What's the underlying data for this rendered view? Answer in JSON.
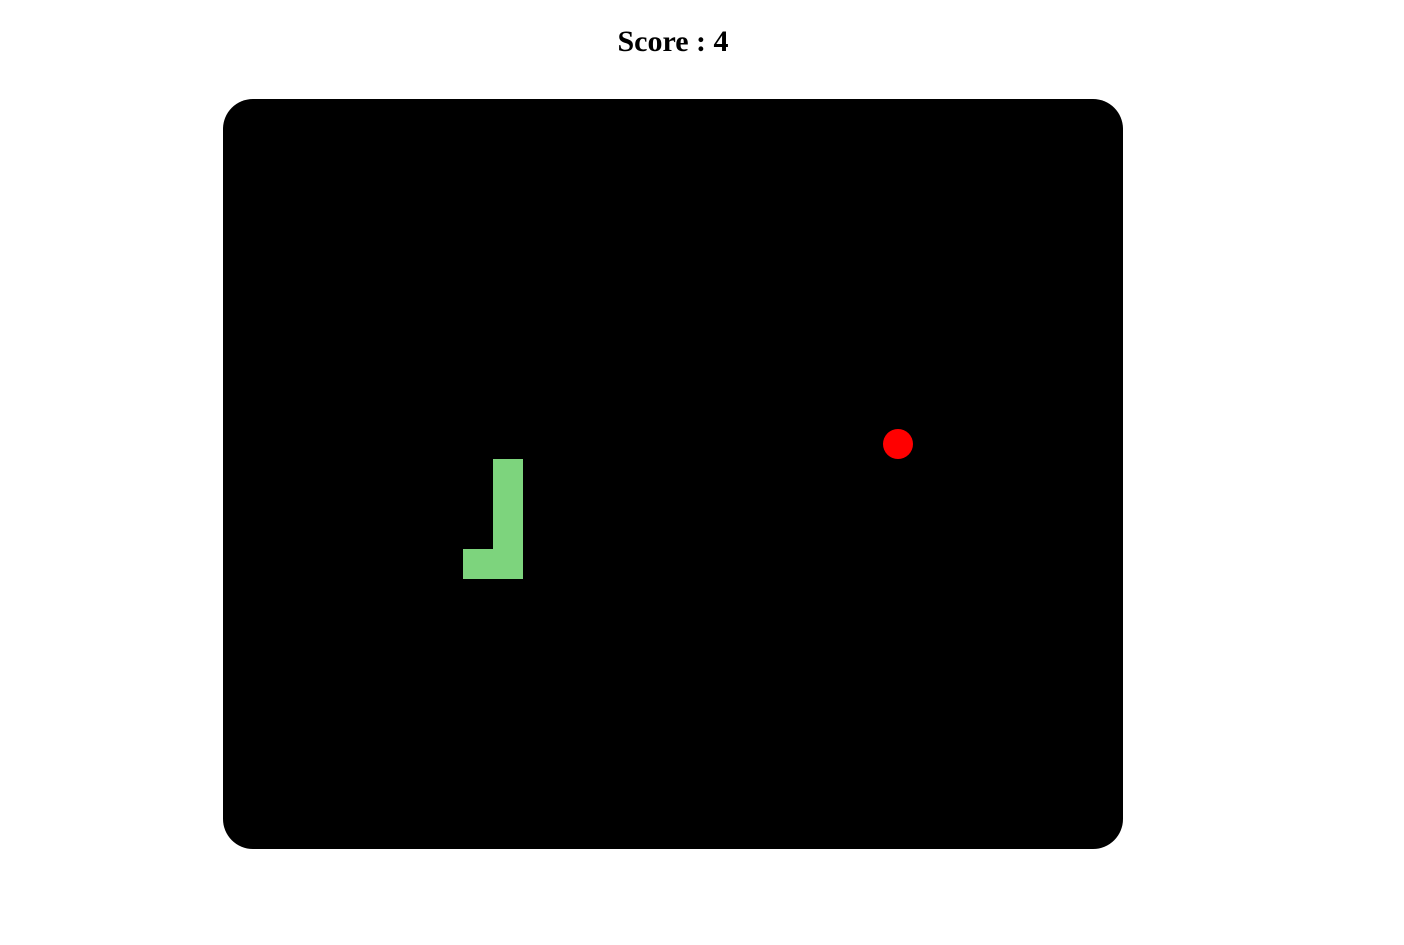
{
  "header": {
    "score_text": "Score : 4",
    "score_value": 4
  },
  "game": {
    "grid_cols": 30,
    "grid_rows": 25,
    "colors": {
      "board": "#000000",
      "snake": "#7dd47d",
      "food": "#ff0000"
    },
    "snake": [
      {
        "col": 9,
        "row": 12
      },
      {
        "col": 9,
        "row": 13
      },
      {
        "col": 9,
        "row": 14
      },
      {
        "col": 9,
        "row": 15
      },
      {
        "col": 8,
        "row": 15
      }
    ],
    "food": {
      "col": 22,
      "row": 11
    }
  }
}
